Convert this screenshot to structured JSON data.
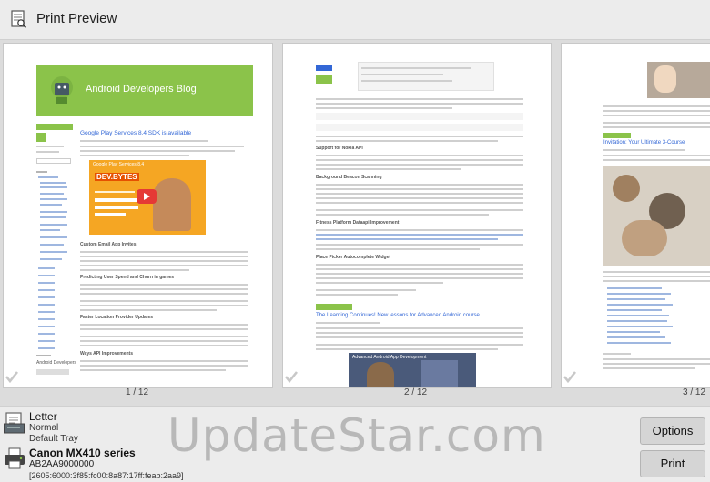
{
  "window": {
    "title": "Print Preview",
    "icon": "print-preview-icon"
  },
  "pages": [
    {
      "label": "1 / 12",
      "blog_banner": "Android Developers Blog",
      "post_title": "Google Play Services 8.4 SDK is available",
      "video_title": "Google Play Services 8.4",
      "video_brand": "DEV.BYTES",
      "section_1": "Custom Email App Invites",
      "section_2": "Predicting User Spend and Churn in games",
      "section_3": "Faster Location Provider Updates",
      "section_4": "Ways API Improvements",
      "sidebar_title": "Android Developers"
    },
    {
      "label": "2 / 12",
      "section_1": "Support for Nokia API",
      "section_2": "Background Beacon Scanning",
      "section_3": "Fitness Platform Dataapi Improvement",
      "section_4": "Place Picker Autocomplete Widget",
      "post_title": "The Learning Continues! New lessons for Advanced Android course",
      "video_title": "Advanced Android App Development"
    },
    {
      "label": "3 / 12",
      "post_title": "Invitation: Your Ultimate 3-Course"
    }
  ],
  "printer_settings": {
    "paper": "Letter",
    "quality": "Normal",
    "tray": "Default Tray",
    "printer_name": "Canon MX410 series",
    "printer_id": "AB2AA9000000",
    "printer_address": "[2605:6000:3f85:fc00:8a87:17ff:feab:2aa9]"
  },
  "buttons": {
    "options": "Options",
    "print": "Print"
  },
  "watermark": "UpdateStar.com",
  "colors": {
    "android_green": "#8bc34a",
    "video_orange": "#f5a623",
    "link_blue": "#3367d6"
  }
}
